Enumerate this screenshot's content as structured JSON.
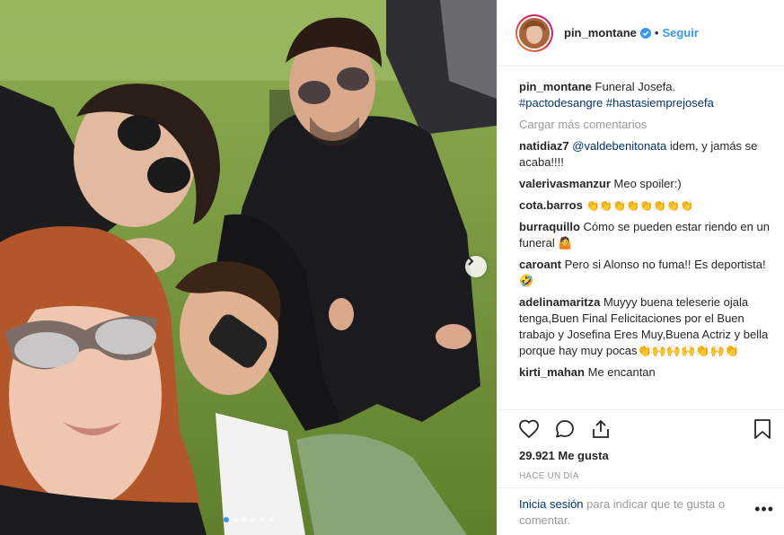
{
  "header": {
    "username": "pin_montane",
    "separator": "•",
    "follow_label": "Seguir"
  },
  "caption": {
    "username": "pin_montane",
    "text": "Funeral Josefa.",
    "hashtags": "#pactodesangre #hastasiemprejosefa"
  },
  "load_more_label": "Cargar más comentarios",
  "comments": [
    {
      "username": "natidiaz7",
      "mention": "@valdebenitonata",
      "text": " idem, y jamás se acaba!!!!"
    },
    {
      "username": "valerivasmanzur",
      "text": "Meo spoiler:)"
    },
    {
      "username": "cota.barros",
      "text": "👏👏👏👏👏👏👏👏"
    },
    {
      "username": "burraquillo",
      "text": "Cómo se pueden estar riendo en un funeral 🤷"
    },
    {
      "username": "caroant",
      "text": "Pero si Alonso no fuma!! Es deportista! 🤣"
    },
    {
      "username": "adelinamaritza",
      "text": "Muyyy buena teleserie ojala tenga,Buen Final Felicitaciones por el Buen trabajo y Josefina Eres Muy,Buena Actriz y bella porque hay muy pocas👏🙌🙌🙌👏🙌👏"
    },
    {
      "username": "kirti_mahan",
      "text": "Me encantan"
    }
  ],
  "likes": "29.921 Me gusta",
  "timestamp": "HACE UN DÍA",
  "login": {
    "link_label": "Inicia sesión",
    "text": " para indicar que te gusta o comentar."
  },
  "more_options": "•••",
  "icons": {
    "like": "heart-icon",
    "comment": "comment-icon",
    "share": "share-icon",
    "save": "bookmark-icon",
    "next": "chevron-right-icon",
    "verified": "verified-badge-icon"
  },
  "colors": {
    "link": "#3897f0",
    "hashtag": "#003569",
    "muted": "#999999",
    "border": "#efefef"
  },
  "carousel": {
    "total": 6,
    "active": 1
  }
}
